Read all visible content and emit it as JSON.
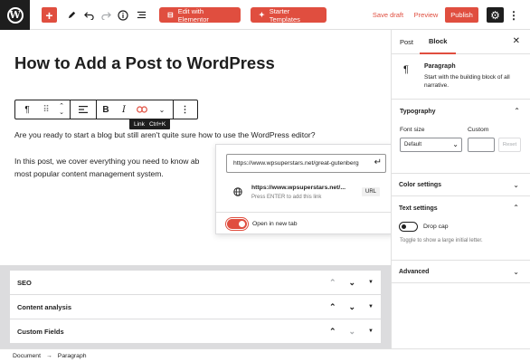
{
  "topbar": {
    "add_icon": "+",
    "edit_elementor": "Edit with Elementor",
    "starter_templates": "Starter Templates",
    "save_draft": "Save draft",
    "preview": "Preview",
    "publish": "Publish"
  },
  "editor": {
    "title": "How to Add a Post to WordPress",
    "paragraph1": "Are you ready to start a blog but still aren't quite sure how to use the WordPress editor?",
    "paragraph2_line1": "In this post, we cover everything you need to know ab",
    "paragraph2_line2": "most popular content management system.",
    "tooltip_label": "Link",
    "tooltip_shortcut": "Ctrl+K"
  },
  "link_popover": {
    "url_value": "https://www.wpsuperstars.net/great-gutenberg",
    "suggestion_title": "https://www.wpsuperstars.net/...",
    "suggestion_hint": "Press ENTER to add this link",
    "suggestion_badge": "URL",
    "new_tab_label": "Open in new tab",
    "new_tab_enabled": true
  },
  "meta_boxes": [
    {
      "label": "SEO"
    },
    {
      "label": "Content analysis"
    },
    {
      "label": "Custom Fields"
    }
  ],
  "footer": {
    "crumb1": "Document",
    "separator": "→",
    "crumb2": "Paragraph"
  },
  "sidebar": {
    "tabs": [
      "Post",
      "Block"
    ],
    "active_tab": "Block",
    "block_name": "Paragraph",
    "block_desc": "Start with the building block of all narrative.",
    "typography": {
      "heading": "Typography",
      "font_size_label": "Font size",
      "font_size_value": "Default",
      "custom_label": "Custom",
      "reset_label": "Reset"
    },
    "color_settings": "Color settings",
    "text_settings": {
      "heading": "Text settings",
      "drop_cap_label": "Drop cap",
      "drop_cap_hint": "Toggle to show a large initial letter.",
      "drop_cap_enabled": false
    },
    "advanced": "Advanced"
  },
  "colors": {
    "accent": "#e04e3f",
    "dark": "#1e1e1e"
  }
}
